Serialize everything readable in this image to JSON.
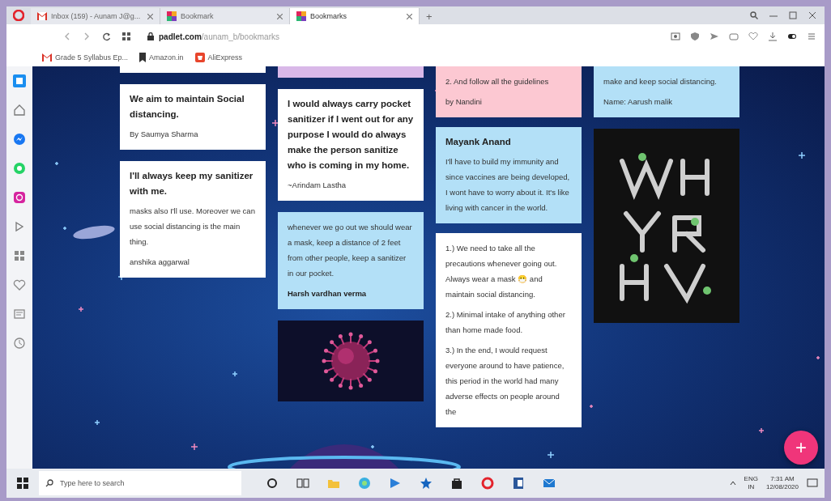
{
  "browser": {
    "tabs": [
      {
        "title": "Inbox (159) - Aunam J@g...",
        "selected": false
      },
      {
        "title": "Bookmark",
        "selected": false
      },
      {
        "title": "Bookmarks",
        "selected": true
      }
    ],
    "new_tab": "+",
    "url_host": "padlet.com",
    "url_path": "/aunam_b/bookmarks",
    "bookmarks": [
      {
        "title": "Grade 5 Syllabus Ep..."
      },
      {
        "title": "Amazon.in"
      },
      {
        "title": "AliExpress"
      }
    ]
  },
  "board": {
    "columns": [
      {
        "cards": [
          {
            "kind": "clipped",
            "color": "#ffffff"
          },
          {
            "kind": "note",
            "color": "#ffffff",
            "title": "We aim to maintain Social distancing.",
            "paragraphs": [
              {
                "text": "By Saumya Sharma",
                "bold": false
              }
            ]
          },
          {
            "kind": "note",
            "color": "#ffffff",
            "title": "I'll always keep my sanitizer with me.",
            "paragraphs": [
              {
                "text": "masks also I'll use. Moreover we can use social distancing is the main thing.",
                "bold": false
              },
              {
                "text": "anshika aggarwal",
                "bold": false
              }
            ]
          }
        ]
      },
      {
        "cards": [
          {
            "kind": "clipped",
            "color": "#d9b8e8"
          },
          {
            "kind": "note",
            "color": "#ffffff",
            "title": "I would always carry pocket sanitizer if I went out for any purpose I would do always make the person sanitize who is coming in my home.",
            "paragraphs": [
              {
                "text": "~Arindam Lastha",
                "bold": false
              }
            ]
          },
          {
            "kind": "note",
            "color": "#b3e0f7",
            "paragraphs": [
              {
                "text": "whenever we go out we should wear a mask, keep a distance of 2 feet from other people, keep a sanitizer in our pocket.",
                "bold": false
              },
              {
                "text": "Harsh vardhan verma",
                "bold": true
              }
            ]
          },
          {
            "kind": "virus",
            "color": "#0d0f2a"
          }
        ]
      },
      {
        "cards": [
          {
            "kind": "note",
            "color": "#fcc8d2",
            "paragraphs": [
              {
                "text": "2. And follow all the guidelines",
                "bold": false
              },
              {
                "text": "by Nandini",
                "bold": false
              }
            ]
          },
          {
            "kind": "note",
            "color": "#b3e0f7",
            "title": "Mayank Anand",
            "paragraphs": [
              {
                "text": "I'll have to build my immunity and since vaccines are being developed, I wont have to worry about it. It's like living with cancer in the world.",
                "bold": false
              }
            ]
          },
          {
            "kind": "note",
            "color": "#ffffff",
            "paragraphs": [
              {
                "text": "1.) We need to take all the precautions whenever going out. Always wear a mask 😷 and maintain social distancing.",
                "bold": false
              },
              {
                "text": "2.) Minimal intake of anything other than home made food.",
                "bold": false
              },
              {
                "text": "3.) In the end, I would request everyone around to have patience, this period in the world had many adverse effects on people around the",
                "bold": false
              }
            ]
          }
        ]
      },
      {
        "cards": [
          {
            "kind": "note",
            "color": "#b3e0f7",
            "paragraphs": [
              {
                "text": "make and keep social distancing.",
                "bold": false
              },
              {
                "text": "Name: Aarush malik",
                "bold": false
              }
            ]
          },
          {
            "kind": "poster",
            "color": "#111111"
          }
        ]
      }
    ],
    "add_button": "+"
  },
  "taskbar": {
    "search_placeholder": "Type here to search",
    "language": "ENG",
    "region": "IN",
    "time": "7:31 AM",
    "date": "12/08/2020"
  }
}
